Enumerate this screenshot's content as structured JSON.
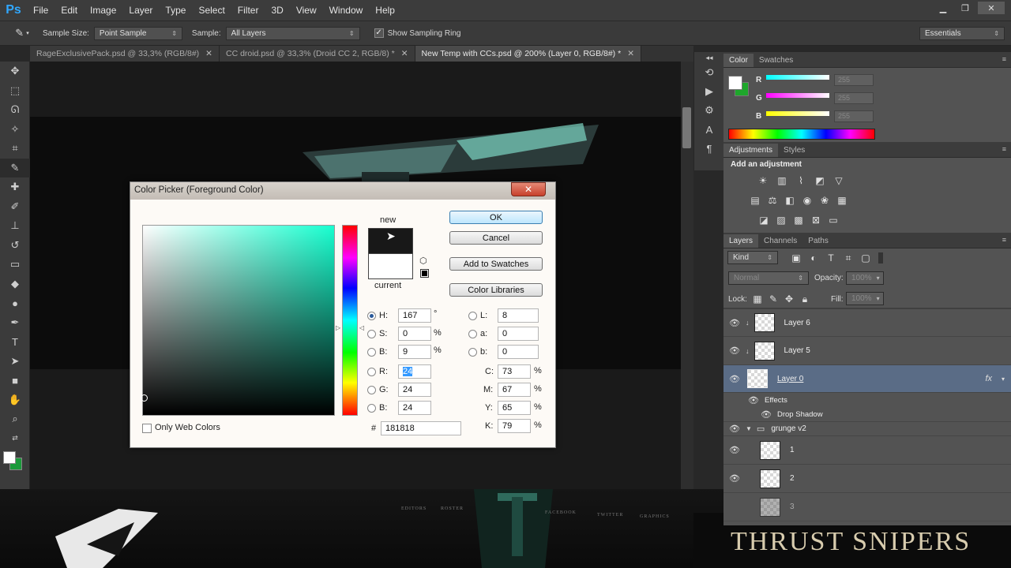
{
  "menubar": {
    "logo": "Ps",
    "items": [
      "File",
      "Edit",
      "Image",
      "Layer",
      "Type",
      "Select",
      "Filter",
      "3D",
      "View",
      "Window",
      "Help"
    ]
  },
  "options": {
    "sample_size_label": "Sample Size:",
    "sample_size_value": "Point Sample",
    "sample_label": "Sample:",
    "sample_value": "All Layers",
    "show_ring_label": "Show Sampling Ring",
    "workspace": "Essentials"
  },
  "tabs": [
    {
      "label": "RageExclusivePack.psd @ 33,3% (RGB/8#)"
    },
    {
      "label": "CC droid.psd @ 33,3% (Droid CC 2, RGB/8) *"
    },
    {
      "label": "New Temp with CCs.psd @ 200% (Layer 0, RGB/8#) *"
    }
  ],
  "color_panel": {
    "tabs": [
      "Color",
      "Swatches"
    ],
    "r_label": "R",
    "g_label": "G",
    "b_label": "B",
    "r_value": "255",
    "g_value": "255",
    "b_value": "255"
  },
  "adjustments_panel": {
    "tabs": [
      "Adjustments",
      "Styles"
    ],
    "heading": "Add an adjustment"
  },
  "layers_panel": {
    "tabs": [
      "Layers",
      "Channels",
      "Paths"
    ],
    "filter_kind": "Kind",
    "blend_mode": "Normal",
    "opacity_label": "Opacity:",
    "opacity_value": "100%",
    "lock_label": "Lock:",
    "fill_label": "Fill:",
    "fill_value": "100%",
    "layers": [
      "Layer 6",
      "Layer 5",
      "Layer 0",
      "Effects",
      "Drop Shadow",
      "grunge v2",
      "1",
      "2",
      "3"
    ],
    "fx": "fx"
  },
  "color_picker": {
    "title": "Color Picker (Foreground Color)",
    "close": "✕",
    "new_label": "new",
    "current_label": "current",
    "ok": "OK",
    "cancel": "Cancel",
    "add_swatches": "Add to Swatches",
    "color_libraries": "Color Libraries",
    "h_label": "H:",
    "h_value": "167",
    "h_unit": "°",
    "s_label": "S:",
    "s_value": "0",
    "s_unit": "%",
    "b_label": "B:",
    "b_value": "9",
    "b_unit": "%",
    "r_label": "R:",
    "r_value": "24",
    "g_label": "G:",
    "g_value": "24",
    "bl_label": "B:",
    "bl_value": "24",
    "l_label": "L:",
    "l_value": "8",
    "a_label": "a:",
    "a_value": "0",
    "lb_label": "b:",
    "lb_value": "0",
    "c_label": "C:",
    "c_value": "73",
    "c_unit": "%",
    "m_label": "M:",
    "m_value": "67",
    "m_unit": "%",
    "y_label": "Y:",
    "y_value": "65",
    "y_unit": "%",
    "k_label": "K:",
    "k_value": "79",
    "k_unit": "%",
    "hex_label": "#",
    "hex_value": "181818",
    "web_colors": "Only Web Colors"
  },
  "banner": {
    "title": "THRUST SNIPERS",
    "nav": [
      "EDITORS",
      "ROSTER",
      "FACEBOOK",
      "TWITTER",
      "GRAPHICS"
    ]
  },
  "colors": {
    "accent": "#31a8ff",
    "selected_layer": "#5a6c86",
    "new_color": "#181818",
    "current_color": "#ffffff"
  }
}
